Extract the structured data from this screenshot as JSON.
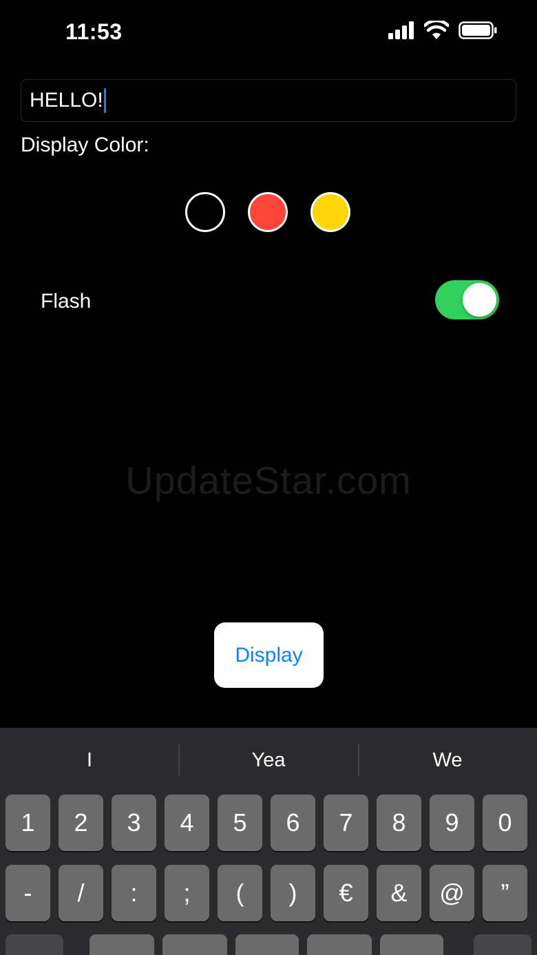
{
  "status_bar": {
    "time": "11:53"
  },
  "text_field": {
    "value": "HELLO!"
  },
  "display_color": {
    "label": "Display Color:",
    "swatches": [
      {
        "name": "black",
        "color": "#000000"
      },
      {
        "name": "red",
        "color": "#ff453a"
      },
      {
        "name": "yellow",
        "color": "#ffd60a"
      }
    ]
  },
  "flash": {
    "label": "Flash",
    "on": true
  },
  "watermark": "UpdateStar.com",
  "display_button": {
    "label": "Display"
  },
  "keyboard": {
    "suggestions": [
      "I",
      "Yea",
      "We"
    ],
    "row1": [
      "1",
      "2",
      "3",
      "4",
      "5",
      "6",
      "7",
      "8",
      "9",
      "0"
    ],
    "row2": [
      "-",
      "/",
      ":",
      ";",
      "(",
      ")",
      "€",
      "&",
      "@",
      "”"
    ]
  },
  "colors": {
    "accent": "#0a84ff",
    "toggle_on": "#30d158"
  }
}
